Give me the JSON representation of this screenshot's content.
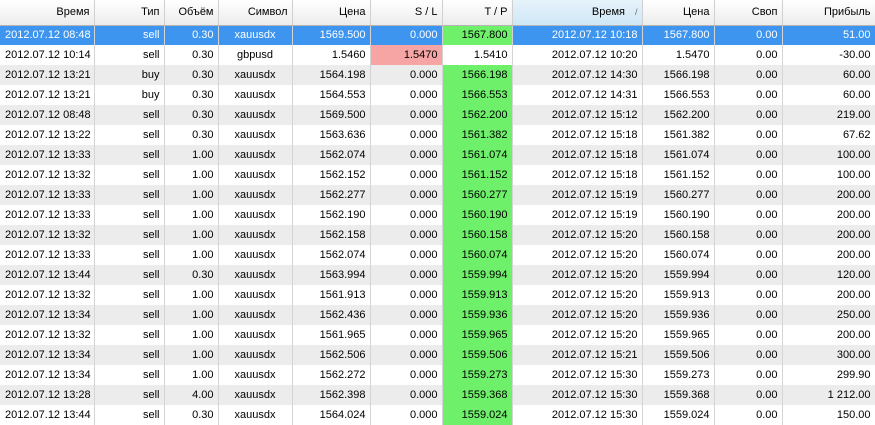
{
  "headers": {
    "open_time": "Время",
    "type": "Тип",
    "volume": "Объём",
    "symbol": "Символ",
    "open_price": "Цена",
    "sl": "S / L",
    "tp": "T / P",
    "close_time": "Время",
    "close_price": "Цена",
    "swap": "Своп",
    "profit": "Прибыль",
    "sort_glyph": "/"
  },
  "colors": {
    "selection": "#3d95f0",
    "tp_hit": "#6ff06a",
    "sl_hit": "#f6a4a4",
    "row_alt": "#ececec"
  },
  "rows": [
    {
      "open_time": "2012.07.12 08:48",
      "type": "sell",
      "volume": "0.30",
      "symbol": "xauusdx",
      "open_price": "1569.500",
      "sl": "0.000",
      "tp": "1567.800",
      "close_time": "2012.07.12 10:18",
      "close_price": "1567.800",
      "swap": "0.00",
      "profit": "51.00",
      "selected": true,
      "hit": "tp"
    },
    {
      "open_time": "2012.07.12 10:14",
      "type": "sell",
      "volume": "0.30",
      "symbol": "gbpusd",
      "open_price": "1.5460",
      "sl": "1.5470",
      "tp": "1.5410",
      "close_time": "2012.07.12 10:20",
      "close_price": "1.5470",
      "swap": "0.00",
      "profit": "-30.00",
      "hit": "sl"
    },
    {
      "open_time": "2012.07.12 13:21",
      "type": "buy",
      "volume": "0.30",
      "symbol": "xauusdx",
      "open_price": "1564.198",
      "sl": "0.000",
      "tp": "1566.198",
      "close_time": "2012.07.12 14:30",
      "close_price": "1566.198",
      "swap": "0.00",
      "profit": "60.00",
      "hit": "tp"
    },
    {
      "open_time": "2012.07.12 13:21",
      "type": "buy",
      "volume": "0.30",
      "symbol": "xauusdx",
      "open_price": "1564.553",
      "sl": "0.000",
      "tp": "1566.553",
      "close_time": "2012.07.12 14:31",
      "close_price": "1566.553",
      "swap": "0.00",
      "profit": "60.00",
      "hit": "tp"
    },
    {
      "open_time": "2012.07.12 08:48",
      "type": "sell",
      "volume": "0.30",
      "symbol": "xauusdx",
      "open_price": "1569.500",
      "sl": "0.000",
      "tp": "1562.200",
      "close_time": "2012.07.12 15:12",
      "close_price": "1562.200",
      "swap": "0.00",
      "profit": "219.00",
      "hit": "tp"
    },
    {
      "open_time": "2012.07.12 13:22",
      "type": "sell",
      "volume": "0.30",
      "symbol": "xauusdx",
      "open_price": "1563.636",
      "sl": "0.000",
      "tp": "1561.382",
      "close_time": "2012.07.12 15:18",
      "close_price": "1561.382",
      "swap": "0.00",
      "profit": "67.62",
      "hit": "tp"
    },
    {
      "open_time": "2012.07.12 13:33",
      "type": "sell",
      "volume": "1.00",
      "symbol": "xauusdx",
      "open_price": "1562.074",
      "sl": "0.000",
      "tp": "1561.074",
      "close_time": "2012.07.12 15:18",
      "close_price": "1561.074",
      "swap": "0.00",
      "profit": "100.00",
      "hit": "tp"
    },
    {
      "open_time": "2012.07.12 13:32",
      "type": "sell",
      "volume": "1.00",
      "symbol": "xauusdx",
      "open_price": "1562.152",
      "sl": "0.000",
      "tp": "1561.152",
      "close_time": "2012.07.12 15:18",
      "close_price": "1561.152",
      "swap": "0.00",
      "profit": "100.00",
      "hit": "tp"
    },
    {
      "open_time": "2012.07.12 13:33",
      "type": "sell",
      "volume": "1.00",
      "symbol": "xauusdx",
      "open_price": "1562.277",
      "sl": "0.000",
      "tp": "1560.277",
      "close_time": "2012.07.12 15:19",
      "close_price": "1560.277",
      "swap": "0.00",
      "profit": "200.00",
      "hit": "tp"
    },
    {
      "open_time": "2012.07.12 13:33",
      "type": "sell",
      "volume": "1.00",
      "symbol": "xauusdx",
      "open_price": "1562.190",
      "sl": "0.000",
      "tp": "1560.190",
      "close_time": "2012.07.12 15:19",
      "close_price": "1560.190",
      "swap": "0.00",
      "profit": "200.00",
      "hit": "tp"
    },
    {
      "open_time": "2012.07.12 13:32",
      "type": "sell",
      "volume": "1.00",
      "symbol": "xauusdx",
      "open_price": "1562.158",
      "sl": "0.000",
      "tp": "1560.158",
      "close_time": "2012.07.12 15:20",
      "close_price": "1560.158",
      "swap": "0.00",
      "profit": "200.00",
      "hit": "tp"
    },
    {
      "open_time": "2012.07.12 13:33",
      "type": "sell",
      "volume": "1.00",
      "symbol": "xauusdx",
      "open_price": "1562.074",
      "sl": "0.000",
      "tp": "1560.074",
      "close_time": "2012.07.12 15:20",
      "close_price": "1560.074",
      "swap": "0.00",
      "profit": "200.00",
      "hit": "tp"
    },
    {
      "open_time": "2012.07.12 13:44",
      "type": "sell",
      "volume": "0.30",
      "symbol": "xauusdx",
      "open_price": "1563.994",
      "sl": "0.000",
      "tp": "1559.994",
      "close_time": "2012.07.12 15:20",
      "close_price": "1559.994",
      "swap": "0.00",
      "profit": "120.00",
      "hit": "tp"
    },
    {
      "open_time": "2012.07.12 13:32",
      "type": "sell",
      "volume": "1.00",
      "symbol": "xauusdx",
      "open_price": "1561.913",
      "sl": "0.000",
      "tp": "1559.913",
      "close_time": "2012.07.12 15:20",
      "close_price": "1559.913",
      "swap": "0.00",
      "profit": "200.00",
      "hit": "tp"
    },
    {
      "open_time": "2012.07.12 13:34",
      "type": "sell",
      "volume": "1.00",
      "symbol": "xauusdx",
      "open_price": "1562.436",
      "sl": "0.000",
      "tp": "1559.936",
      "close_time": "2012.07.12 15:20",
      "close_price": "1559.936",
      "swap": "0.00",
      "profit": "250.00",
      "hit": "tp"
    },
    {
      "open_time": "2012.07.12 13:32",
      "type": "sell",
      "volume": "1.00",
      "symbol": "xauusdx",
      "open_price": "1561.965",
      "sl": "0.000",
      "tp": "1559.965",
      "close_time": "2012.07.12 15:20",
      "close_price": "1559.965",
      "swap": "0.00",
      "profit": "200.00",
      "hit": "tp"
    },
    {
      "open_time": "2012.07.12 13:34",
      "type": "sell",
      "volume": "1.00",
      "symbol": "xauusdx",
      "open_price": "1562.506",
      "sl": "0.000",
      "tp": "1559.506",
      "close_time": "2012.07.12 15:21",
      "close_price": "1559.506",
      "swap": "0.00",
      "profit": "300.00",
      "hit": "tp"
    },
    {
      "open_time": "2012.07.12 13:34",
      "type": "sell",
      "volume": "1.00",
      "symbol": "xauusdx",
      "open_price": "1562.272",
      "sl": "0.000",
      "tp": "1559.273",
      "close_time": "2012.07.12 15:30",
      "close_price": "1559.273",
      "swap": "0.00",
      "profit": "299.90",
      "hit": "tp"
    },
    {
      "open_time": "2012.07.12 13:28",
      "type": "sell",
      "volume": "4.00",
      "symbol": "xauusdx",
      "open_price": "1562.398",
      "sl": "0.000",
      "tp": "1559.368",
      "close_time": "2012.07.12 15:30",
      "close_price": "1559.368",
      "swap": "0.00",
      "profit": "1 212.00",
      "hit": "tp"
    },
    {
      "open_time": "2012.07.12 13:44",
      "type": "sell",
      "volume": "0.30",
      "symbol": "xauusdx",
      "open_price": "1564.024",
      "sl": "0.000",
      "tp": "1559.024",
      "close_time": "2012.07.12 15:30",
      "close_price": "1559.024",
      "swap": "0.00",
      "profit": "150.00",
      "hit": "tp"
    }
  ]
}
